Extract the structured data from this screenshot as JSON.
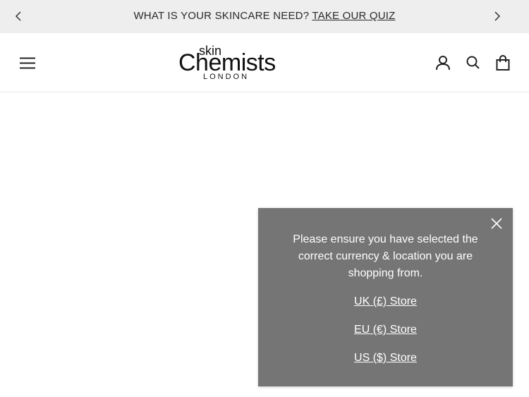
{
  "announcement": {
    "text": "WHAT IS YOUR SKINCARE NEED?",
    "link": "TAKE OUR QUIZ"
  },
  "header": {
    "logo": {
      "skin": "skin",
      "chemists": "Chemists",
      "london": "LONDON"
    },
    "icons": [
      "menu-icon",
      "account-icon",
      "search-icon",
      "cart-icon"
    ]
  },
  "popup": {
    "message": "Please ensure you have selected the correct currency & location you are shopping from.",
    "stores": {
      "uk": "UK (£) Store",
      "eu": "EU (€) Store",
      "us": "US ($) Store"
    }
  },
  "colors": {
    "announcement_bg": "#eeeeee",
    "popup_bg": "#757575",
    "text_dark": "#1c1c1c"
  }
}
